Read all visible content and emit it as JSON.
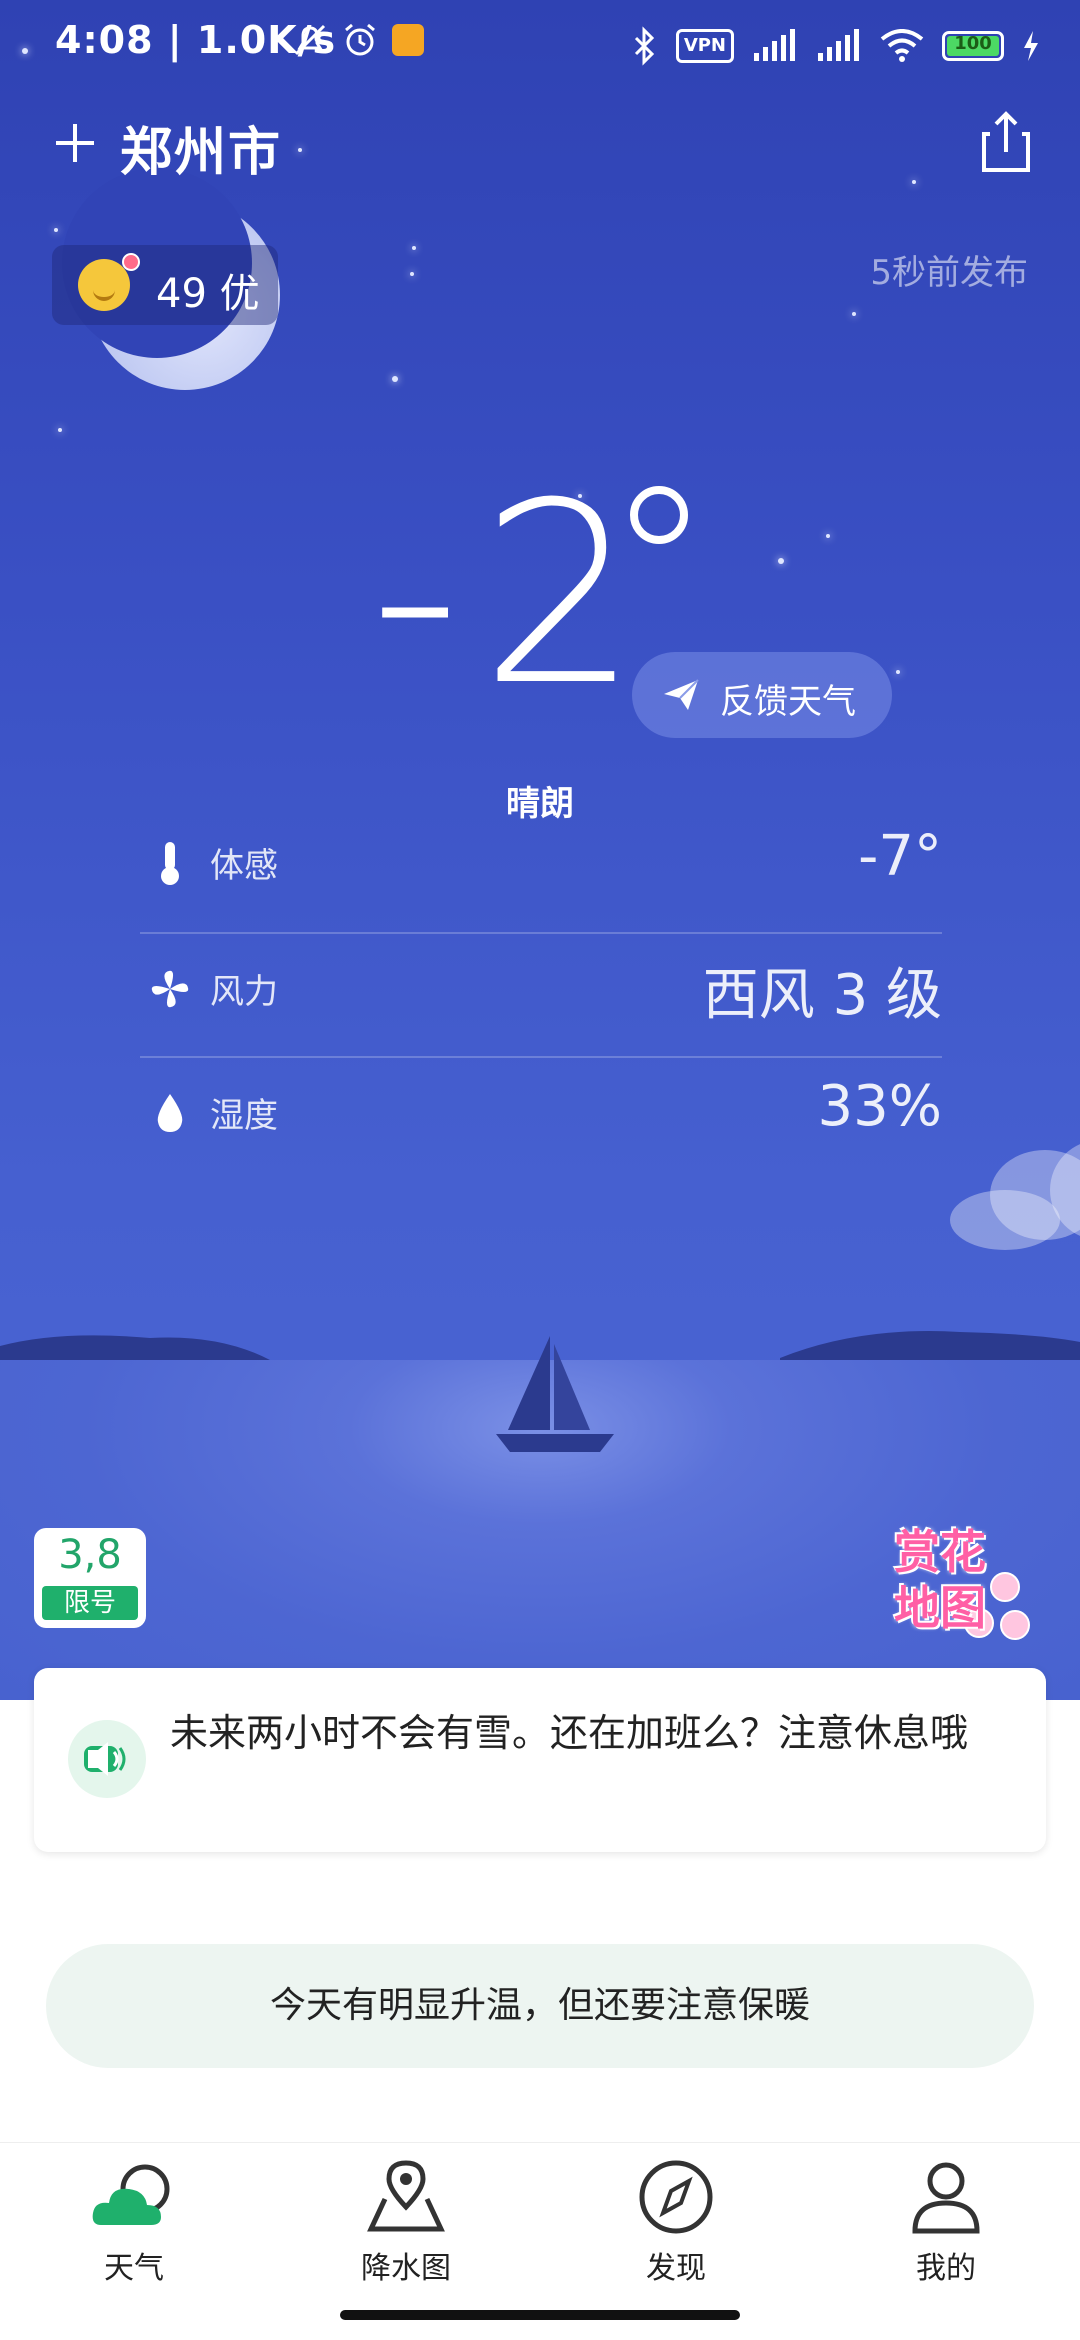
{
  "status_bar": {
    "time": "4:08",
    "net_speed": "1.0K/s",
    "vpn": "VPN",
    "battery": "100"
  },
  "header": {
    "city": "郑州市"
  },
  "aqi": {
    "label": "49 优"
  },
  "published": "5秒前发布",
  "current": {
    "temperature": "-2",
    "condition": "晴朗",
    "feedback_label": "反馈天气"
  },
  "details": [
    {
      "label": "体感",
      "value": "-7°"
    },
    {
      "label": "风力",
      "value": "西风 3 级"
    },
    {
      "label": "湿度",
      "value": "33%"
    }
  ],
  "limit": {
    "numbers": "3,8",
    "tag": "限号"
  },
  "flower_map": {
    "line1": "赏花",
    "line2": "地图"
  },
  "notice": "未来两小时不会有雪。还在加班么？注意休息哦",
  "tip": "今天有明显升温，但还要注意保暖",
  "tabs": [
    {
      "label": "天气"
    },
    {
      "label": "降水图"
    },
    {
      "label": "发现"
    },
    {
      "label": "我的"
    }
  ],
  "colors": {
    "sky_top": "#2f42b3",
    "sky_bottom": "#4d67d4",
    "accent_green": "#1fb06c"
  }
}
